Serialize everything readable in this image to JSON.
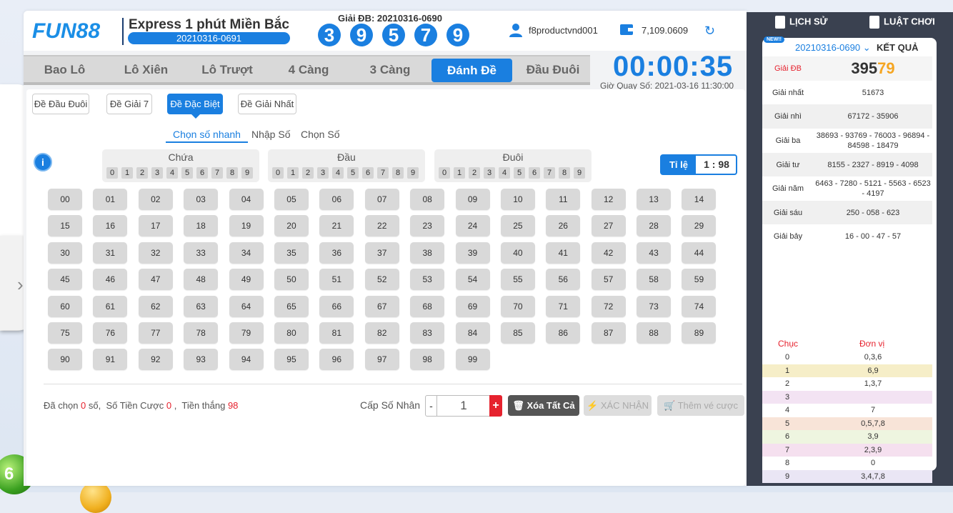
{
  "header": {
    "logo": "FUN88",
    "game_title": "Express 1 phút Miền Bắc",
    "current_period": "20210316-0691",
    "last_db_label": "Giải ĐB: 20210316-0690",
    "last_balls": [
      "3",
      "9",
      "5",
      "7",
      "9"
    ],
    "username": "f8productvnd001",
    "balance": "7,109.0609"
  },
  "nav": {
    "tabs": [
      "Bao Lô",
      "Lô Xiên",
      "Lô Trượt",
      "4 Càng",
      "3 Càng",
      "Đánh Đề",
      "Đầu Đuôi"
    ],
    "active": "Đánh Đề"
  },
  "timer": {
    "countdown": "00:00:35",
    "draw_time": "Giờ Quay Số: 2021-03-16 11:30:00"
  },
  "subtabs": [
    "Đề Đầu Đuôi",
    "Đề Giải 7",
    "Đề Đặc Biệt",
    "Đề Giải Nhất"
  ],
  "modes": [
    "Chọn số nhanh",
    "Nhập Số",
    "Chọn Số"
  ],
  "filters": {
    "contain": "Chứa",
    "head": "Đầu",
    "tail": "Đuôi",
    "digits": [
      "0",
      "1",
      "2",
      "3",
      "4",
      "5",
      "6",
      "7",
      "8",
      "9"
    ]
  },
  "ratio": {
    "label": "Tỉ lệ",
    "value": "1 : 98"
  },
  "numbers": [
    "00",
    "01",
    "02",
    "03",
    "04",
    "05",
    "06",
    "07",
    "08",
    "09",
    "10",
    "11",
    "12",
    "13",
    "14",
    "15",
    "16",
    "17",
    "18",
    "19",
    "20",
    "21",
    "22",
    "23",
    "24",
    "25",
    "26",
    "27",
    "28",
    "29",
    "30",
    "31",
    "32",
    "33",
    "34",
    "35",
    "36",
    "37",
    "38",
    "39",
    "40",
    "41",
    "42",
    "43",
    "44",
    "45",
    "46",
    "47",
    "48",
    "49",
    "50",
    "51",
    "52",
    "53",
    "54",
    "55",
    "56",
    "57",
    "58",
    "59",
    "60",
    "61",
    "62",
    "63",
    "64",
    "65",
    "66",
    "67",
    "68",
    "69",
    "70",
    "71",
    "72",
    "73",
    "74",
    "75",
    "76",
    "77",
    "78",
    "79",
    "80",
    "81",
    "82",
    "83",
    "84",
    "85",
    "86",
    "87",
    "88",
    "89",
    "90",
    "91",
    "92",
    "93",
    "94",
    "95",
    "96",
    "97",
    "98",
    "99"
  ],
  "summary": {
    "chosen_prefix": "Đã chọn",
    "chosen_count": "0",
    "chosen_suffix": "số,",
    "bet_prefix": "Số Tiền Cược",
    "bet_amount": "0",
    "win_prefix": "Tiền thắng",
    "win_amount": "98"
  },
  "multiplier": {
    "label": "Cấp Số Nhân",
    "minus": "-",
    "value": "1",
    "plus": "+"
  },
  "buttons": {
    "clear": "Xóa Tất Cả",
    "confirm": "XÁC NHẬN",
    "add_ticket": "Thêm vé cược"
  },
  "right_panel": {
    "history": "LỊCH SỬ",
    "rules": "LUẬT CHƠI",
    "new_badge": "NEW!!",
    "period": "20210316-0690",
    "result": "KẾT QUẢ",
    "db_label": "Giải ĐB",
    "db_main": "395",
    "db_highlight": "79",
    "prizes": [
      {
        "label": "Giải nhất",
        "value": "51673"
      },
      {
        "label": "Giải nhì",
        "value": "67172 - 35906"
      },
      {
        "label": "Giải ba",
        "value": "38693 - 93769 - 76003 - 96894 - 84598 - 18479"
      },
      {
        "label": "Giải tư",
        "value": "8155 - 2327 - 8919 - 4098"
      },
      {
        "label": "Giải năm",
        "value": "6463 - 7280 - 5121 - 5563 - 6523 - 4197"
      },
      {
        "label": "Giải sáu",
        "value": "250 - 058 - 623"
      },
      {
        "label": "Giải bảy",
        "value": "16 - 00 - 47 - 57"
      }
    ],
    "stats_head": {
      "chuc": "Chục",
      "donvi": "Đơn vị"
    },
    "stats": [
      {
        "c": "0",
        "v": "0,3,6"
      },
      {
        "c": "1",
        "v": "6,9"
      },
      {
        "c": "2",
        "v": "1,3,7"
      },
      {
        "c": "3",
        "v": ""
      },
      {
        "c": "4",
        "v": "7"
      },
      {
        "c": "5",
        "v": "0,5,7,8"
      },
      {
        "c": "6",
        "v": "3,9"
      },
      {
        "c": "7",
        "v": "2,3,9"
      },
      {
        "c": "8",
        "v": "0"
      },
      {
        "c": "9",
        "v": "3,4,7,8"
      }
    ]
  },
  "colors": {
    "accent": "#1a7fe0",
    "danger": "#e6222e",
    "highlight": "#f5a623",
    "panel": "#3a4150"
  }
}
